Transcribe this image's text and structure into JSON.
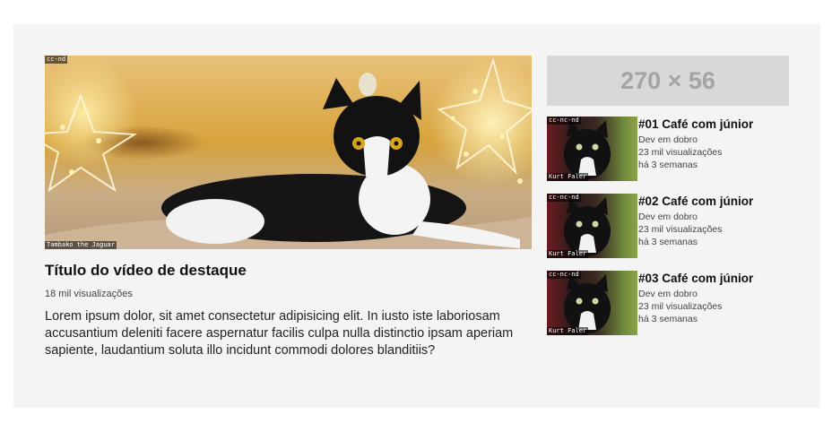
{
  "featured": {
    "license": "cc-nd",
    "credit": "Tambako the Jaguar",
    "title": "Título do vídeo de destaque",
    "views": "18 mil visualizações",
    "description": "Lorem ipsum dolor, sit amet consectetur adipisicing elit. In iusto iste laboriosam accusantium deleniti facere aspernatur facilis culpa nulla distinctio ipsam aperiam sapiente, laudantium soluta illo incidunt commodi dolores blanditiis?"
  },
  "ad": {
    "placeholder": "270 × 56"
  },
  "sidebar": {
    "items": [
      {
        "license": "cc-nc-nd",
        "credit": "Kurt Faler",
        "title": "#01 Café com júnior",
        "channel": "Dev em dobro",
        "views": "23 mil visualizações",
        "age": "há 3 semanas"
      },
      {
        "license": "cc-nc-nd",
        "credit": "Kurt Faler",
        "title": "#02 Café com júnior",
        "channel": "Dev em dobro",
        "views": "23 mil visualizações",
        "age": "há 3 semanas"
      },
      {
        "license": "cc-nc-nd",
        "credit": "Kurt Faler",
        "title": "#03 Café com júnior",
        "channel": "Dev em dobro",
        "views": "23 mil visualizações",
        "age": "há 3 semanas"
      }
    ]
  }
}
